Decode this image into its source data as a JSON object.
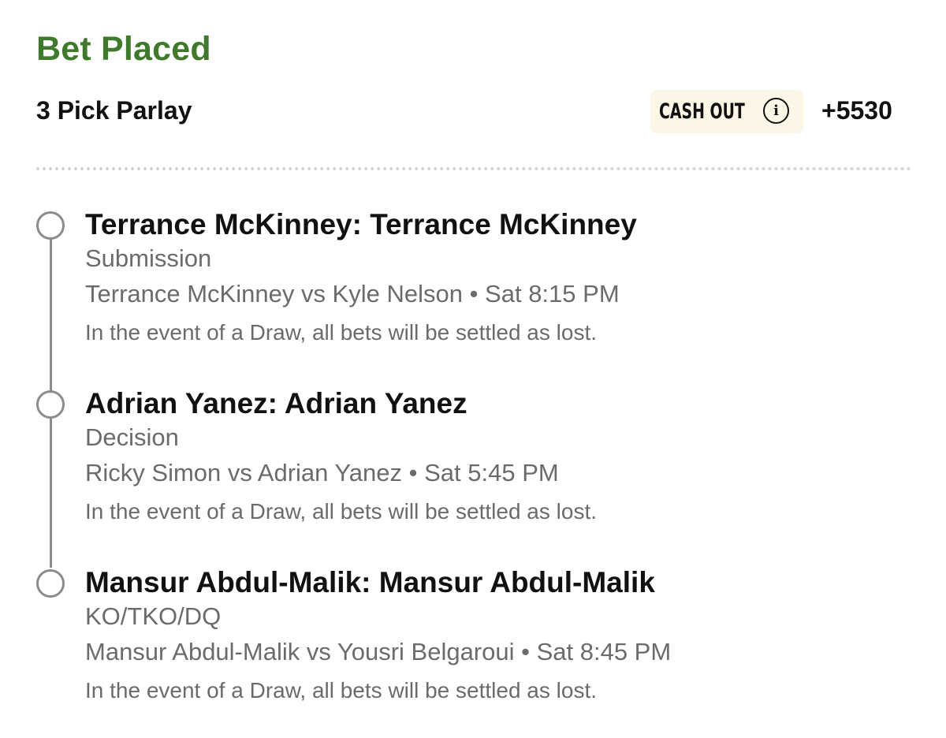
{
  "header": {
    "status": "Bet Placed",
    "bet_type": "3 Pick Parlay",
    "cash_out_label": "CASH OUT",
    "info_icon_glyph": "i",
    "odds": "+5530"
  },
  "colors": {
    "status_green": "#3f7a2c",
    "cash_out_bg": "#fbf6e6",
    "secondary_text": "#6b6b6b",
    "timeline_gray": "#8c8c8c"
  },
  "picks": [
    {
      "title": "Terrance McKinney: Terrance McKinney",
      "market": "Submission",
      "event": "Terrance McKinney vs Kyle Nelson • Sat 8:15 PM",
      "rule": "In the event of a Draw, all bets will be settled as lost."
    },
    {
      "title": "Adrian Yanez: Adrian Yanez",
      "market": "Decision",
      "event": "Ricky Simon vs Adrian Yanez • Sat 5:45 PM",
      "rule": "In the event of a Draw, all bets will be settled as lost."
    },
    {
      "title": "Mansur Abdul-Malik: Mansur Abdul-Malik",
      "market": "KO/TKO/DQ",
      "event": "Mansur Abdul-Malik vs Yousri Belgaroui • Sat 8:45 PM",
      "rule": "In the event of a Draw, all bets will be settled as lost."
    }
  ]
}
